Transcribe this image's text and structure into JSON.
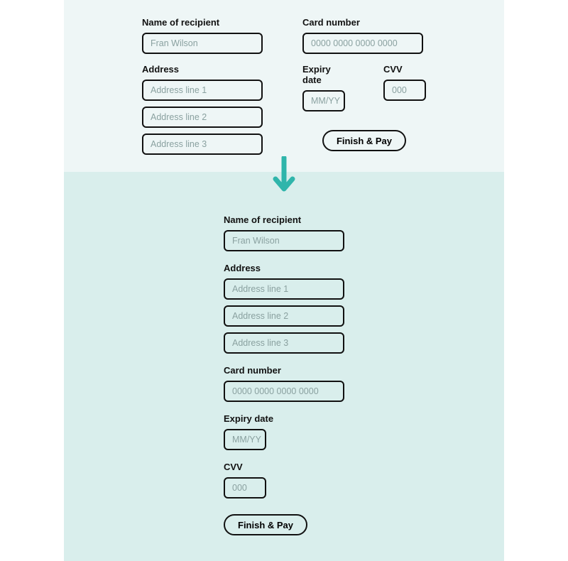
{
  "labels": {
    "recipient": "Name of recipient",
    "address": "Address",
    "card": "Card number",
    "expiry": "Expiry date",
    "cvv": "CVV"
  },
  "placeholders": {
    "recipient": "Fran Wilson",
    "addr1": "Address line 1",
    "addr2": "Address line 2",
    "addr3": "Address line 3",
    "card": "0000 0000 0000 0000",
    "expiry": "MM/YY",
    "cvv": "000"
  },
  "buttons": {
    "finish": "Finish & Pay"
  },
  "colors": {
    "teal": "#2fb5ab",
    "bg_top": "#eef6f6",
    "bg_bottom": "#d9eeec"
  }
}
